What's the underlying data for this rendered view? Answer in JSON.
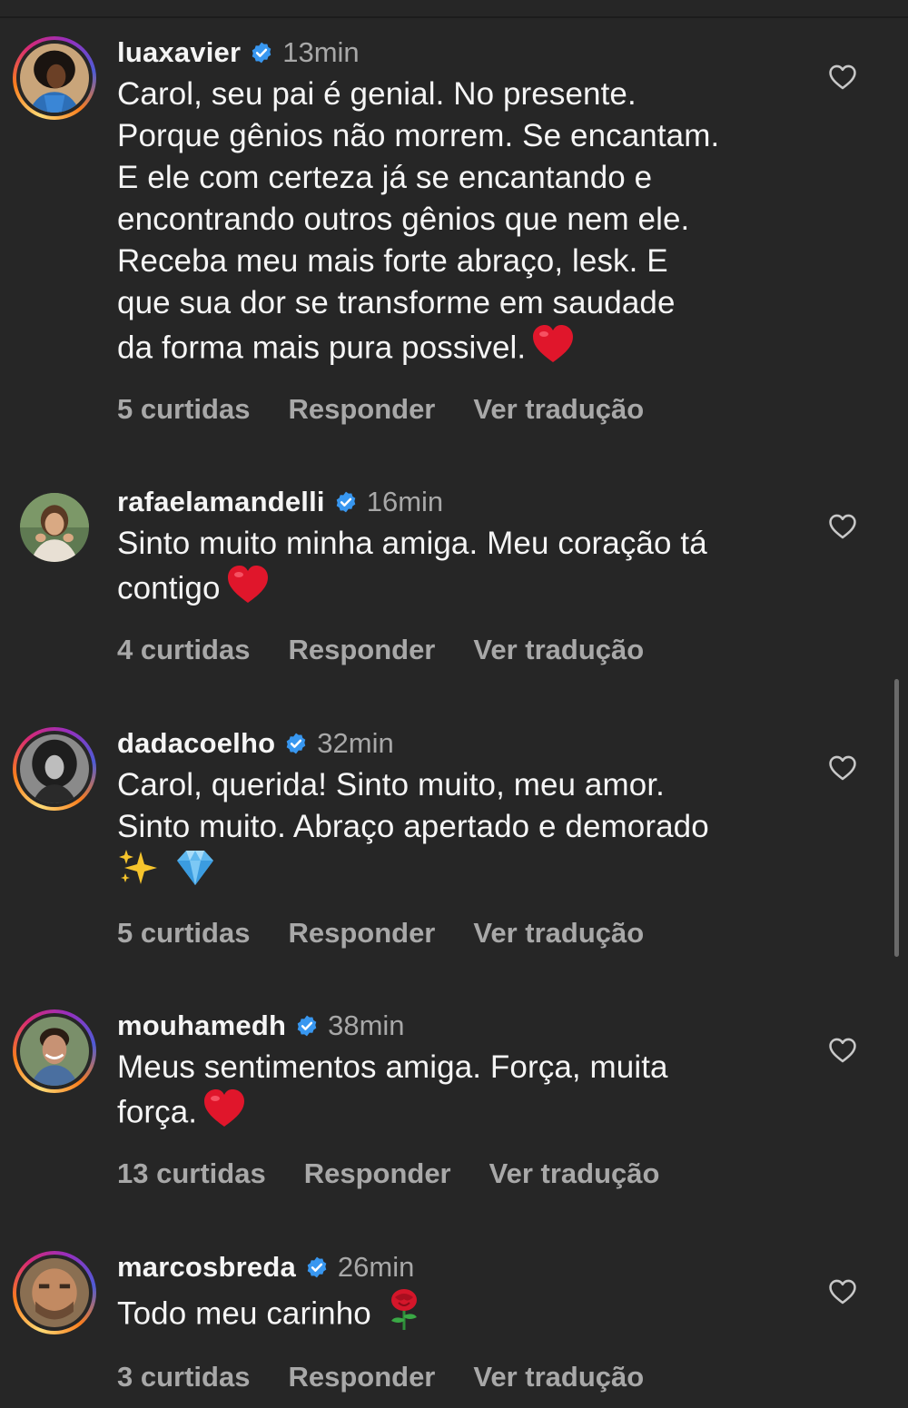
{
  "colors": {
    "background": "#262626",
    "text": "#f5f5f5",
    "muted": "#a8a8a8",
    "verified": "#3897f0",
    "heart_emoji": "#e0162b"
  },
  "comments": [
    {
      "username": "luaxavier",
      "verified": true,
      "time": "13min",
      "text_lines": [
        "Carol, seu pai é genial. No presente.",
        "Porque gênios não morrem. Se encantam.",
        "E ele com certeza já se encantando e",
        "encontrando outros gênios que nem ele.",
        "Receba meu mais forte abraço, lesk. E",
        "que sua dor se transforme em saudade",
        "da forma mais pura possivel."
      ],
      "emoji": "red-heart",
      "likes": "5 curtidas",
      "reply": "Responder",
      "translate": "Ver tradução"
    },
    {
      "username": "rafaelamandelli",
      "verified": true,
      "time": "16min",
      "text_lines": [
        "Sinto muito minha amiga. Meu coração tá",
        "contigo"
      ],
      "emoji": "red-heart",
      "likes": "4 curtidas",
      "reply": "Responder",
      "translate": "Ver tradução"
    },
    {
      "username": "dadacoelho",
      "verified": true,
      "time": "32min",
      "text_lines": [
        "Carol, querida! Sinto muito, meu amor.",
        "Sinto muito. Abraço apertado e demorado"
      ],
      "emoji": "sparkles-gem",
      "likes": "5 curtidas",
      "reply": "Responder",
      "translate": "Ver tradução"
    },
    {
      "username": "mouhamedh",
      "verified": true,
      "time": "38min",
      "text_lines": [
        "Meus sentimentos amiga. Força, muita",
        "força."
      ],
      "emoji": "red-heart",
      "likes": "13 curtidas",
      "reply": "Responder",
      "translate": "Ver tradução"
    },
    {
      "username": "marcosbreda",
      "verified": true,
      "time": "26min",
      "text_lines": [
        "Todo meu carinho"
      ],
      "emoji": "rose",
      "likes": "3 curtidas",
      "reply": "Responder",
      "translate": "Ver tradução"
    }
  ]
}
